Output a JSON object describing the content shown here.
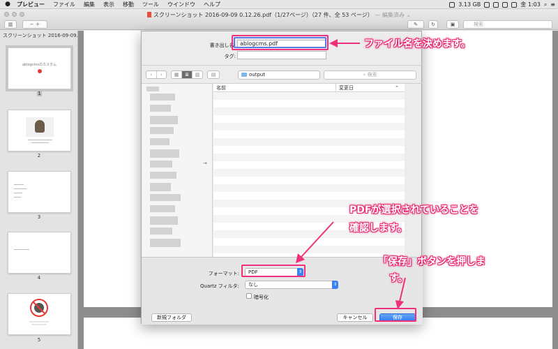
{
  "menubar": {
    "apple": "",
    "items": [
      "プレビュー",
      "ファイル",
      "編集",
      "表示",
      "移動",
      "ツール",
      "ウインドウ",
      "ヘルプ"
    ],
    "storage": "3.13 GB",
    "clock": "金 1:03"
  },
  "window": {
    "title": "スクリーンショット 2016-09-09 0.12.26.pdf（1/27ページ）（27 件、全 53 ページ）",
    "edited": " — 編集済み ⌄",
    "search_placeholder": "検索"
  },
  "sidebar": {
    "header": "スクリーンショット 2016-09-09...",
    "pages": [
      "1",
      "2",
      "3",
      "4",
      "5"
    ],
    "thumb1_text": "ablogcmsのカスタム"
  },
  "dialog": {
    "save_as_label": "書き出し名:",
    "save_as_value": "ablogcms.pdf",
    "tags_label": "タグ:",
    "tags_value": "",
    "location": "output",
    "search_placeholder": "検索",
    "col_name": "名前",
    "col_modified": "変更日",
    "format_label": "フォーマット:",
    "format_value": "PDF",
    "quartz_label": "Quartz フィルタ:",
    "quartz_value": "なし",
    "encrypt_label": "暗号化",
    "new_folder": "新規フォルダ",
    "cancel": "キャンセル",
    "save": "保存"
  },
  "annotations": {
    "filename": "ファイル名を決めます。",
    "pdf_line1": "PDFが選択されていることを",
    "pdf_line2": "確認します。",
    "save_line1": "「保存」ボタンを押しま",
    "save_line2": "す。"
  },
  "colors": {
    "annotation": "#f0307a",
    "focus_ring": "#5c7ae8",
    "primary_button": "#2f7af2"
  }
}
